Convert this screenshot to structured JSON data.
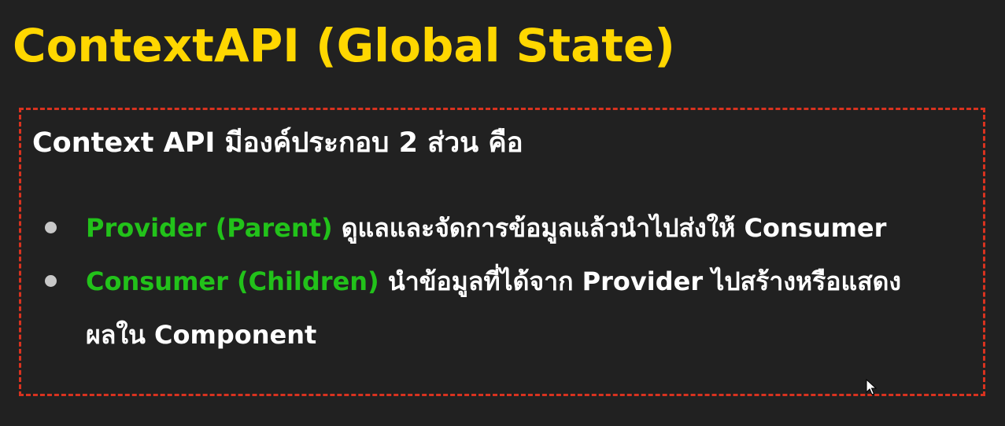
{
  "slide": {
    "title": "ContextAPI (Global State)",
    "subtitle": "Context API มีองค์ประกอบ 2 ส่วน คือ",
    "bullets": [
      {
        "term": "Provider (Parent)",
        "description": " ดูแลและจัดการข้อมูลแล้วนำไปส่งให้ Consumer",
        "description_line2": ""
      },
      {
        "term": "Consumer (Children)",
        "description": " นำข้อมูลที่ได้จาก Provider ไปสร้างหรือแสดง",
        "description_line2": "ผลใน Component"
      }
    ]
  },
  "icons": {
    "bullet": "bullet-dot-icon",
    "cursor": "mouse-pointer-icon"
  },
  "colors": {
    "background": "#212121",
    "title": "#ffd700",
    "text": "#ffffff",
    "term": "#22c21a",
    "bullet": "#c8c8c8",
    "border": "#d8321f"
  }
}
